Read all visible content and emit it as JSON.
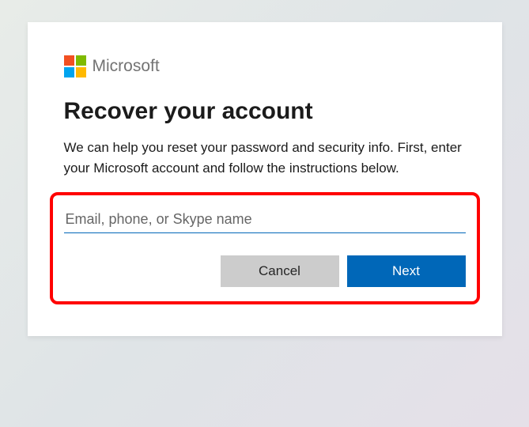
{
  "brand": {
    "name": "Microsoft",
    "logo_colors": {
      "tl": "#f25022",
      "tr": "#7fba00",
      "bl": "#00a4ef",
      "br": "#ffb900"
    }
  },
  "title": "Recover your account",
  "description": "We can help you reset your password and security info. First, enter your Microsoft account and follow the instructions below.",
  "input": {
    "placeholder": "Email, phone, or Skype name",
    "value": ""
  },
  "buttons": {
    "cancel": "Cancel",
    "next": "Next"
  },
  "colors": {
    "primary": "#0067b8",
    "highlight_border": "#ff0000"
  }
}
